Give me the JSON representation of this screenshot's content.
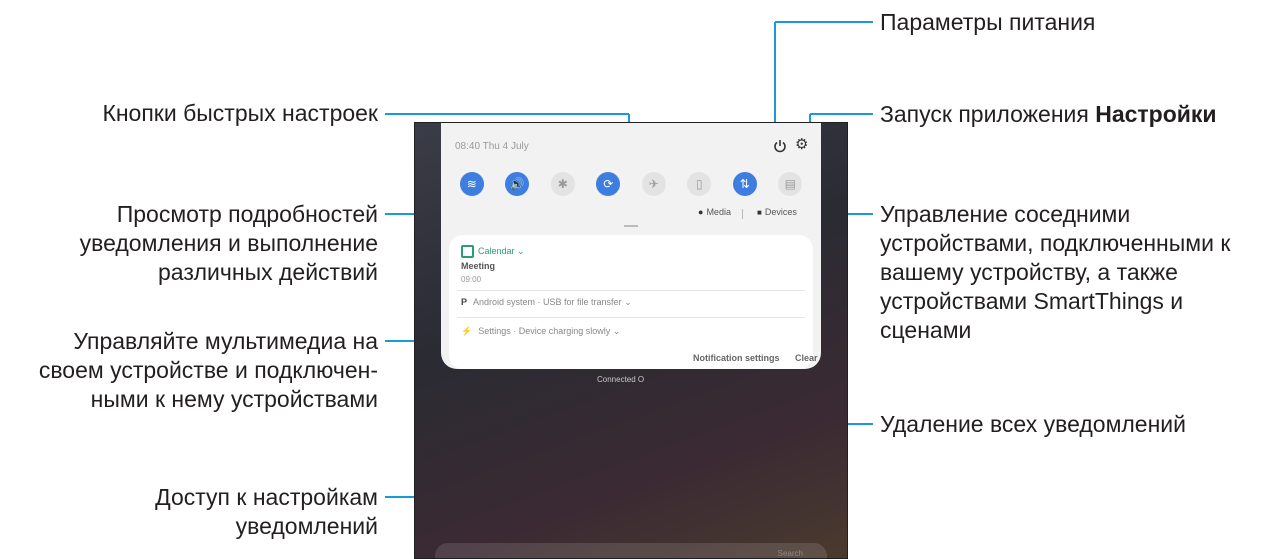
{
  "callouts": {
    "power": "Параметры питания",
    "settings_prefix": "Запуск приложения ",
    "settings_bold": "Настройки",
    "quick_buttons": "Кнопки быстрых настроек",
    "details_l1": "Просмотр подробностей",
    "details_l2": "уведомления и выполнение",
    "details_l3": "различных действий",
    "devices_l1": "Управление соседними",
    "devices_l2": "устройствами, подключенными к",
    "devices_l3": "вашему устройству, а также",
    "devices_l4": "устройствами SmartThings и",
    "devices_l5": "сценами",
    "media_l1": "Управляйте мультимедиа на",
    "media_l2": "своем устройстве и подключен-",
    "media_l3": "ными к нему устройствами",
    "clear_all": "Удаление всех уведомлений",
    "notif_settings_l1": "Доступ к настройкам",
    "notif_settings_l2": "уведомлений"
  },
  "device": {
    "status": "08:40  Thu 4 July",
    "quick_settings": [
      {
        "icon": "wifi-icon",
        "glyph": "≋",
        "on": true
      },
      {
        "icon": "sound-icon",
        "glyph": "🔊",
        "on": true
      },
      {
        "icon": "bluetooth-icon",
        "glyph": "✱",
        "on": false
      },
      {
        "icon": "auto-rotate-icon",
        "glyph": "⟳",
        "on": true
      },
      {
        "icon": "airplane-icon",
        "glyph": "✈",
        "on": false
      },
      {
        "icon": "power-saving-icon",
        "glyph": "▯",
        "on": false
      },
      {
        "icon": "mobile-data-icon",
        "glyph": "⇅",
        "on": true
      },
      {
        "icon": "screen-share-icon",
        "glyph": "▤",
        "on": false
      }
    ],
    "media_label": "Media",
    "devices_label": "Devices",
    "notif1_app": "Calendar",
    "notif1_title": "Meeting",
    "notif1_time": "09:00",
    "notif2": "Android system · USB for file transfer",
    "notif3": "Settings · Device charging slowly",
    "notification_settings": "Notification settings",
    "clear": "Clear",
    "below_panel": "Connected O",
    "search_hint": "Search"
  },
  "colors": {
    "accent_line": "#1b9ad6",
    "toggle_on": "#3d7ee0"
  }
}
